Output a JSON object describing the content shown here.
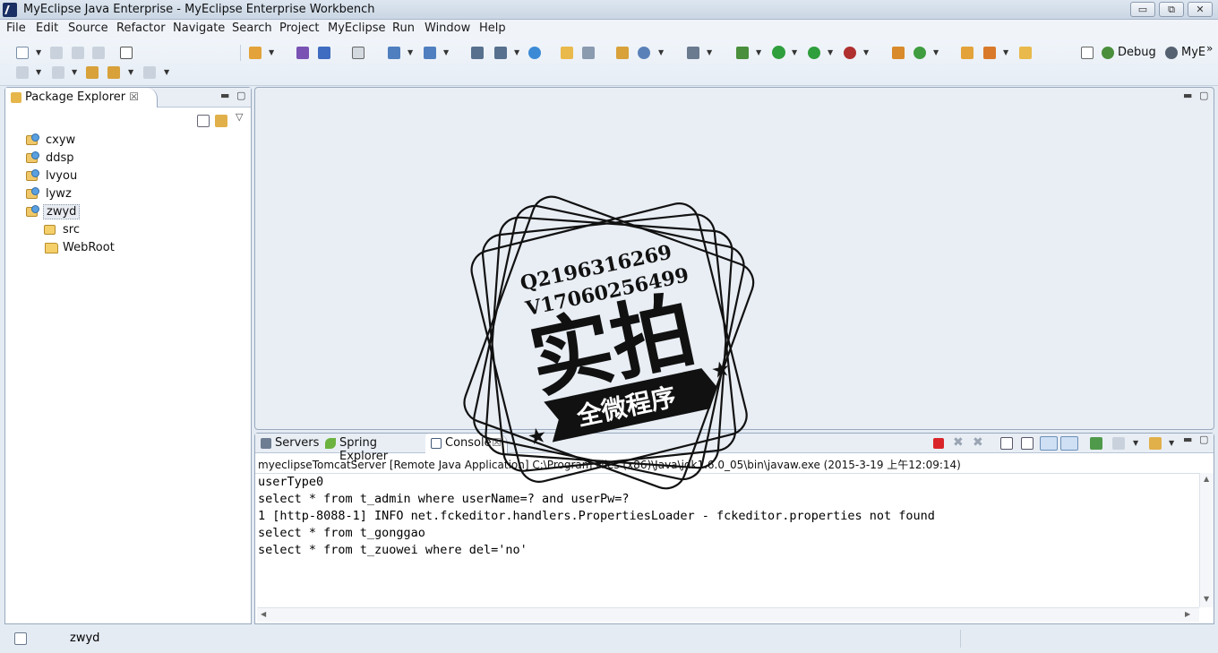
{
  "window": {
    "title": "MyEclipse Java Enterprise - MyEclipse Enterprise Workbench",
    "minimize_glyph": "▭",
    "restore_glyph": "⧉",
    "close_glyph": "✕"
  },
  "menu": [
    "File",
    "Edit",
    "Source",
    "Refactor",
    "Navigate",
    "Search",
    "Project",
    "MyEclipse",
    "Run",
    "Window",
    "Help"
  ],
  "perspectives": {
    "debug_label": "Debug",
    "myeclipse_label": "MyE",
    "overflow_glyph": "»"
  },
  "package_explorer": {
    "tab_label": "Package Explorer",
    "projects": [
      "cxyw",
      "ddsp",
      "lvyou",
      "lywz",
      "zwyd"
    ],
    "children": [
      "src",
      "WebRoot"
    ]
  },
  "bottom_panel": {
    "tabs": [
      "Servers",
      "Spring Explorer",
      "Console"
    ],
    "launch_info": "myeclipseTomcatServer [Remote Java Application] C:\\Program Files (x86)\\Java\\jdk1.6.0_05\\bin\\javaw.exe (2015-3-19 上午12:09:14)",
    "console_lines": [
      "userType0",
      "select * from t_admin where userName=? and userPw=?",
      "1 [http-8088-1] INFO net.fckeditor.handlers.PropertiesLoader - fckeditor.properties not found",
      "select * from t_gonggao",
      "select * from t_zuowei where del='no'"
    ]
  },
  "status_bar": {
    "selection": "zwyd"
  },
  "watermark": {
    "line1": "Q2196316269",
    "line2": "V17060256499",
    "big_text": "实拍",
    "banner_text": "全微程序"
  },
  "colors": {
    "accent": "#1a2f63",
    "stop_red": "#d9252a",
    "run_green": "#2f9e3c"
  }
}
